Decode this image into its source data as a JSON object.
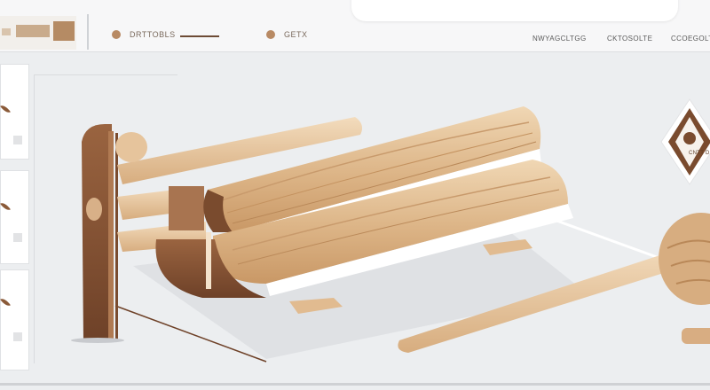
{
  "nav": {
    "item1_label": "DRTTOBLS",
    "item2_label": "GETX"
  },
  "right_links": [
    "NWYAGCLTGG",
    "CKTOSOLTE",
    "CCOEGOLTE"
  ],
  "badge": {
    "label": "CNTT D"
  },
  "colors": {
    "wood_light": "#e8c9a2",
    "wood_mid": "#d4a87b",
    "wood_dark": "#7a4b2e",
    "accent": "#8a5a38"
  }
}
